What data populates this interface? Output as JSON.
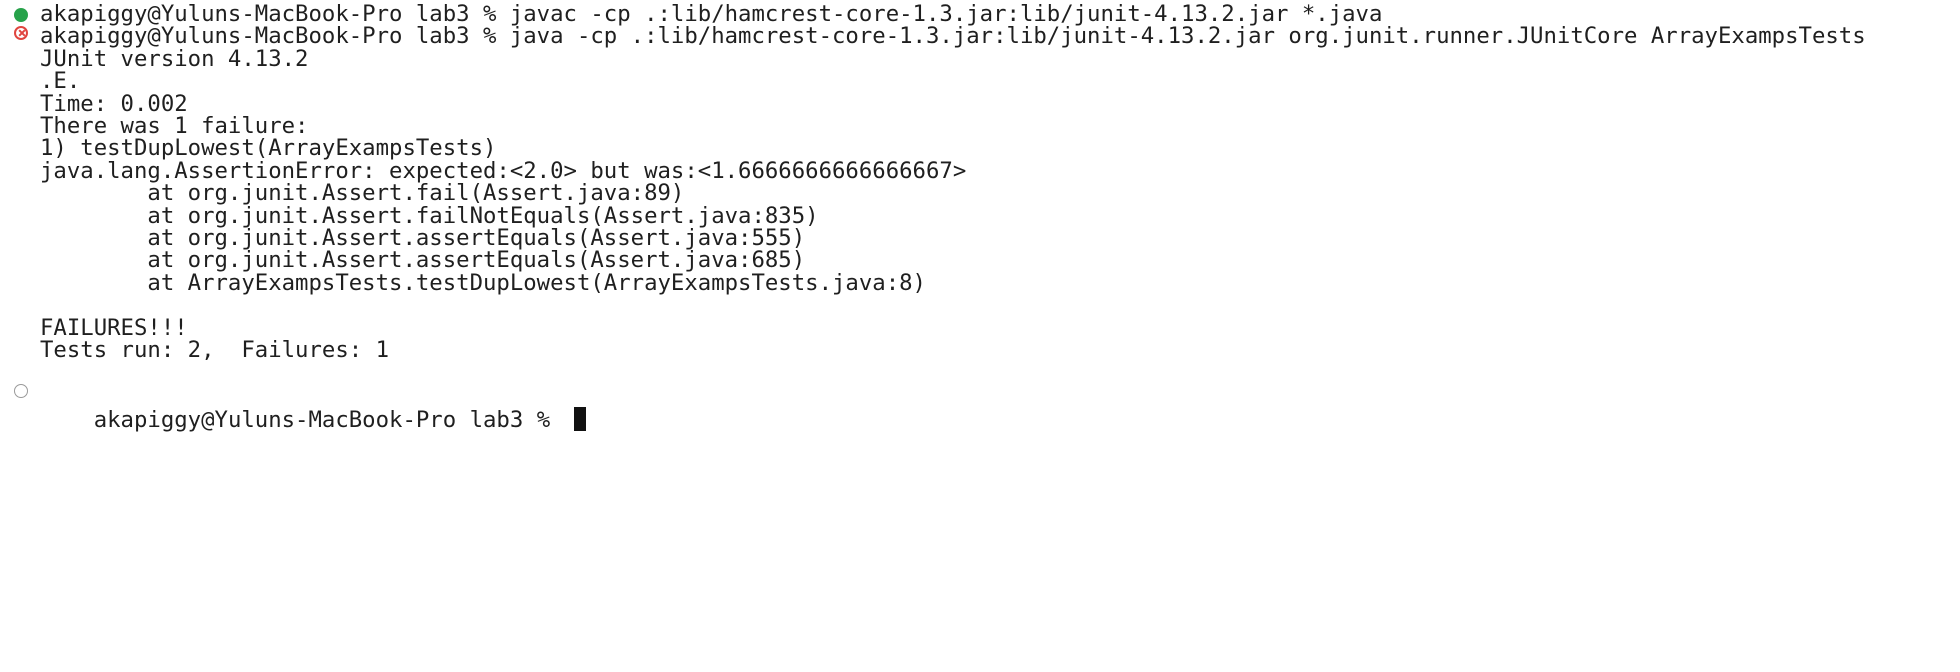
{
  "terminal": {
    "lines": [
      "akapiggy@Yuluns-MacBook-Pro lab3 % javac -cp .:lib/hamcrest-core-1.3.jar:lib/junit-4.13.2.jar *.java",
      "akapiggy@Yuluns-MacBook-Pro lab3 % java -cp .:lib/hamcrest-core-1.3.jar:lib/junit-4.13.2.jar org.junit.runner.JUnitCore ArrayExampsTests",
      "JUnit version 4.13.2",
      ".E.",
      "Time: 0.002",
      "There was 1 failure:",
      "1) testDupLowest(ArrayExampsTests)",
      "java.lang.AssertionError: expected:<2.0> but was:<1.6666666666666667>",
      "        at org.junit.Assert.fail(Assert.java:89)",
      "        at org.junit.Assert.failNotEquals(Assert.java:835)",
      "        at org.junit.Assert.assertEquals(Assert.java:555)",
      "        at org.junit.Assert.assertEquals(Assert.java:685)",
      "        at ArrayExampsTests.testDupLowest(ArrayExampsTests.java:8)",
      "",
      "FAILURES!!!",
      "Tests run: 2,  Failures: 1",
      "",
      "akapiggy@Yuluns-MacBook-Pro lab3 % "
    ]
  },
  "colors": {
    "success_marker": "#27a24a",
    "error_marker": "#e0453f",
    "idle_marker": "#9a9a9a"
  }
}
